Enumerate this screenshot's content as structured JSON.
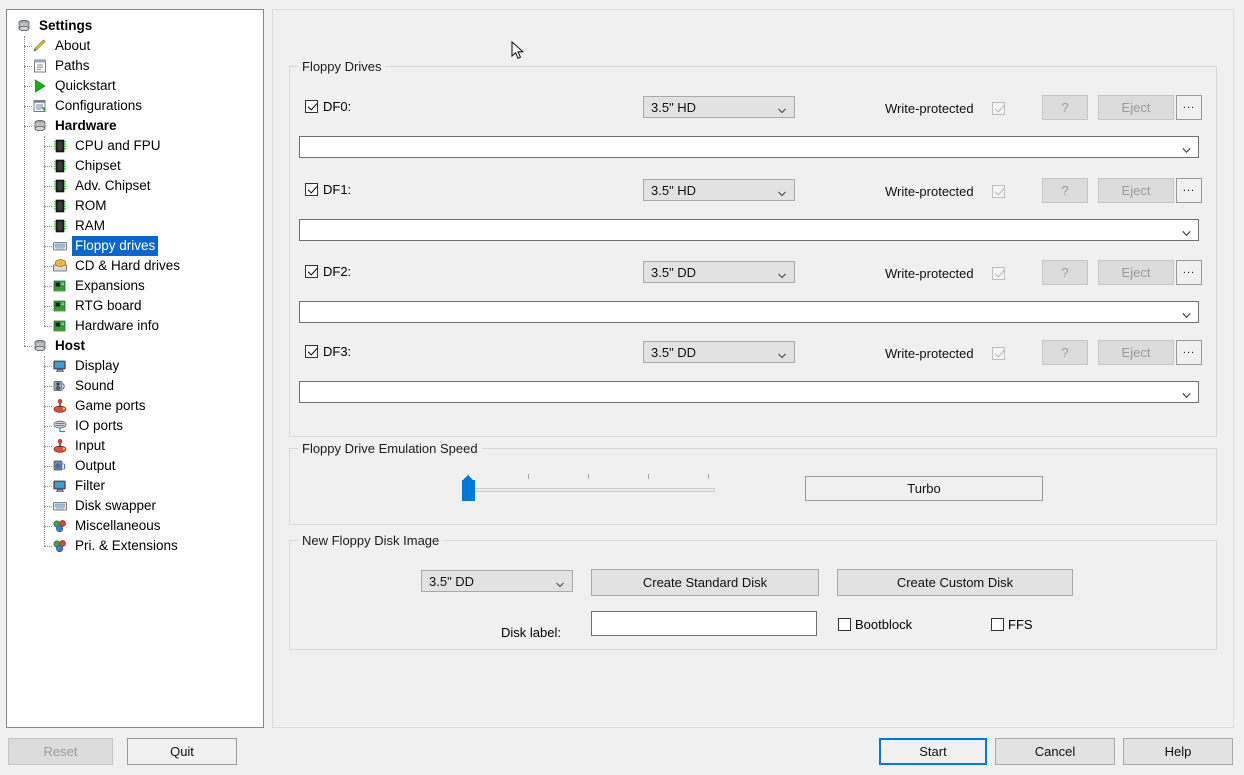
{
  "sidebar": {
    "items": [
      {
        "label": "Settings",
        "level": 0,
        "bold": true,
        "icon": "settings-icon",
        "selected": false
      },
      {
        "label": "About",
        "level": 1,
        "bold": false,
        "icon": "about-icon",
        "selected": false
      },
      {
        "label": "Paths",
        "level": 1,
        "bold": false,
        "icon": "paths-icon",
        "selected": false
      },
      {
        "label": "Quickstart",
        "level": 1,
        "bold": false,
        "icon": "quickstart-icon",
        "selected": false
      },
      {
        "label": "Configurations",
        "level": 1,
        "bold": false,
        "icon": "configurations-icon",
        "selected": false
      },
      {
        "label": "Hardware",
        "level": 1,
        "bold": true,
        "icon": "hardware-icon",
        "selected": false
      },
      {
        "label": "CPU and FPU",
        "level": 2,
        "bold": false,
        "icon": "chip-icon",
        "selected": false
      },
      {
        "label": "Chipset",
        "level": 2,
        "bold": false,
        "icon": "chip-icon",
        "selected": false
      },
      {
        "label": "Adv. Chipset",
        "level": 2,
        "bold": false,
        "icon": "chip-icon",
        "selected": false
      },
      {
        "label": "ROM",
        "level": 2,
        "bold": false,
        "icon": "chip-icon",
        "selected": false
      },
      {
        "label": "RAM",
        "level": 2,
        "bold": false,
        "icon": "chip-icon",
        "selected": false
      },
      {
        "label": "Floppy drives",
        "level": 2,
        "bold": false,
        "icon": "floppy-icon",
        "selected": true
      },
      {
        "label": "CD & Hard drives",
        "level": 2,
        "bold": false,
        "icon": "cd-hard-drives-icon",
        "selected": false
      },
      {
        "label": "Expansions",
        "level": 2,
        "bold": false,
        "icon": "board-icon",
        "selected": false
      },
      {
        "label": "RTG board",
        "level": 2,
        "bold": false,
        "icon": "board-icon",
        "selected": false
      },
      {
        "label": "Hardware info",
        "level": 2,
        "bold": false,
        "icon": "board-icon",
        "selected": false
      },
      {
        "label": "Host",
        "level": 1,
        "bold": true,
        "icon": "host-icon",
        "selected": false
      },
      {
        "label": "Display",
        "level": 2,
        "bold": false,
        "icon": "display-icon",
        "selected": false
      },
      {
        "label": "Sound",
        "level": 2,
        "bold": false,
        "icon": "sound-icon",
        "selected": false
      },
      {
        "label": "Game ports",
        "level": 2,
        "bold": false,
        "icon": "joystick-icon",
        "selected": false
      },
      {
        "label": "IO ports",
        "level": 2,
        "bold": false,
        "icon": "io-ports-icon",
        "selected": false
      },
      {
        "label": "Input",
        "level": 2,
        "bold": false,
        "icon": "joystick-icon",
        "selected": false
      },
      {
        "label": "Output",
        "level": 2,
        "bold": false,
        "icon": "output-icon",
        "selected": false
      },
      {
        "label": "Filter",
        "level": 2,
        "bold": false,
        "icon": "display-icon",
        "selected": false
      },
      {
        "label": "Disk swapper",
        "level": 2,
        "bold": false,
        "icon": "floppy-icon",
        "selected": false
      },
      {
        "label": "Miscellaneous",
        "level": 2,
        "bold": false,
        "icon": "misc-icon",
        "selected": false
      },
      {
        "label": "Pri. & Extensions",
        "level": 2,
        "bold": false,
        "icon": "misc-icon",
        "selected": false
      }
    ]
  },
  "floppy_drives": {
    "legend": "Floppy Drives",
    "write_protected_label": "Write-protected",
    "help_button_label": "?",
    "eject_button_label": "Eject",
    "browse_button_label": "...",
    "path_placeholder": "",
    "drives": [
      {
        "name": "DF0:",
        "enabled": true,
        "type": "3.5\" HD",
        "write_protected": true,
        "path": ""
      },
      {
        "name": "DF1:",
        "enabled": true,
        "type": "3.5\" HD",
        "write_protected": true,
        "path": ""
      },
      {
        "name": "DF2:",
        "enabled": true,
        "type": "3.5\" DD",
        "write_protected": true,
        "path": ""
      },
      {
        "name": "DF3:",
        "enabled": true,
        "type": "3.5\" DD",
        "write_protected": true,
        "path": ""
      }
    ]
  },
  "emulation_speed": {
    "legend": "Floppy Drive Emulation Speed",
    "turbo_label": "Turbo",
    "slider_value": 0,
    "slider_min": 0,
    "slider_max": 100,
    "tick_count": 5
  },
  "new_disk": {
    "legend": "New Floppy Disk Image",
    "type": "3.5\" DD",
    "create_standard_label": "Create Standard Disk",
    "create_custom_label": "Create Custom Disk",
    "disk_label_caption": "Disk label:",
    "disk_label_value": "",
    "bootblock_label": "Bootblock",
    "bootblock_checked": false,
    "ffs_label": "FFS",
    "ffs_checked": false
  },
  "bottom_bar": {
    "reset_label": "Reset",
    "reset_enabled": false,
    "quit_label": "Quit",
    "start_label": "Start",
    "cancel_label": "Cancel",
    "help_label": "Help"
  },
  "colors": {
    "accent": "#0078d7",
    "selection": "#0a67c9",
    "window_bg": "#f0f0f0"
  }
}
